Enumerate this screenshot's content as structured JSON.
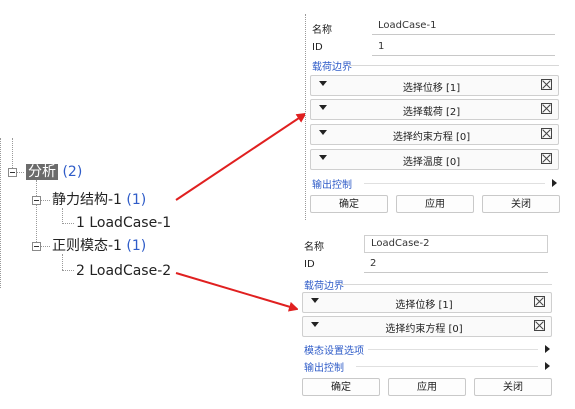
{
  "tree": {
    "root": {
      "label": "分析",
      "count": "(2)"
    },
    "children": [
      {
        "label": "静力结构-1",
        "count": "(1)",
        "case": "1 LoadCase-1"
      },
      {
        "label": "正则模态-1",
        "count": "(1)",
        "case": "2 LoadCase-2"
      }
    ]
  },
  "panel1": {
    "name_label": "名称",
    "name_value": "LoadCase-1",
    "id_label": "ID",
    "id_value": "1",
    "section": "载荷边界",
    "rows": [
      "选择位移 [1]",
      "选择载荷 [2]",
      "选择约束方程 [0]",
      "选择温度 [0]"
    ],
    "output": "输出控制",
    "buttons": [
      "确定",
      "应用",
      "关闭"
    ]
  },
  "panel2": {
    "name_label": "名称",
    "name_value": "LoadCase-2",
    "id_label": "ID",
    "id_value": "2",
    "section": "载荷边界",
    "rows": [
      "选择位移 [1]",
      "选择约束方程 [0]"
    ],
    "modal": "模态设置选项",
    "output": "输出控制",
    "buttons": [
      "确定",
      "应用",
      "关闭"
    ]
  },
  "colors": {
    "accent": "#2f5cc8",
    "arrow": "#e02020",
    "selected": "#6b6b6b"
  }
}
